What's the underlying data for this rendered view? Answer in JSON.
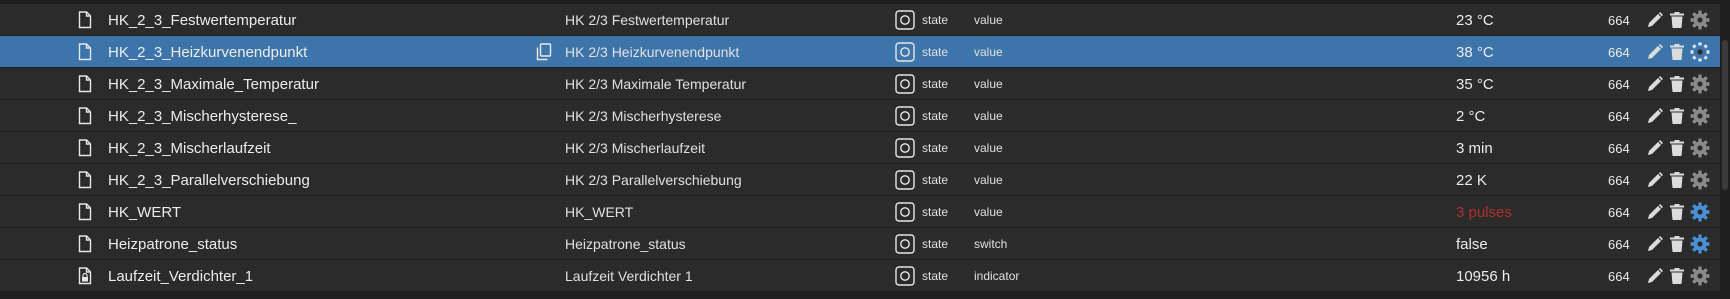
{
  "colors": {
    "row_background": "#2b2b2b",
    "selected_row_background": "#3d74aa",
    "warning_value": "#b03030",
    "settings_accent": "#4a90d9"
  },
  "rows": [
    {
      "id": "HK_2_3_Festwertemperatur",
      "name": "HK 2/3 Festwertemperatur",
      "type": "state",
      "role": "value",
      "value": "23 °C",
      "acl": "664",
      "icon": "file-icon",
      "selected": false
    },
    {
      "id": "HK_2_3_Heizkurvenendpunkt",
      "name": "HK 2/3 Heizkurvenendpunkt",
      "type": "state",
      "role": "value",
      "value": "38 °C",
      "acl": "664",
      "icon": "file-icon",
      "selected": true,
      "copy_icon": "copy-icon"
    },
    {
      "id": "HK_2_3_Maximale_Temperatur",
      "name": "HK 2/3 Maximale Temperatur",
      "type": "state",
      "role": "value",
      "value": "35 °C",
      "acl": "664",
      "icon": "file-icon",
      "selected": false
    },
    {
      "id": "HK_2_3_Mischerhysterese_",
      "name": "HK 2/3 Mischerhysterese",
      "type": "state",
      "role": "value",
      "value": "2 °C",
      "acl": "664",
      "icon": "file-icon",
      "selected": false
    },
    {
      "id": "HK_2_3_Mischerlaufzeit",
      "name": "HK 2/3 Mischerlaufzeit",
      "type": "state",
      "role": "value",
      "value": "3 min",
      "acl": "664",
      "icon": "file-icon",
      "selected": false
    },
    {
      "id": "HK_2_3_Parallelverschiebung",
      "name": "HK 2/3 Parallelverschiebung",
      "type": "state",
      "role": "value",
      "value": "22 K",
      "acl": "664",
      "icon": "file-icon",
      "selected": false
    },
    {
      "id": "HK_WERT",
      "name": "HK_WERT",
      "type": "state",
      "role": "value",
      "value": "3 pulses",
      "acl": "664",
      "icon": "file-icon",
      "selected": false,
      "value_warning": true,
      "settings_active": true
    },
    {
      "id": "Heizpatrone_status",
      "name": "Heizpatrone_status",
      "type": "state",
      "role": "switch",
      "value": "false",
      "acl": "664",
      "icon": "file-icon",
      "selected": false,
      "settings_active": true
    },
    {
      "id": "Laufzeit_Verdichter_1",
      "name": "Laufzeit Verdichter 1",
      "type": "state",
      "role": "indicator",
      "value": "10956 h",
      "acl": "664",
      "icon": "locked-file-icon",
      "selected": false
    }
  ]
}
